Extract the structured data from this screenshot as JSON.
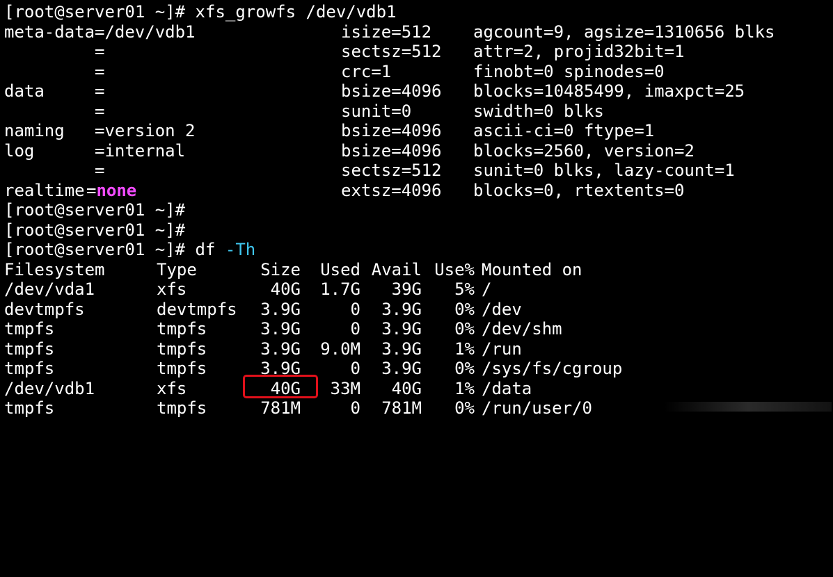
{
  "xfs_growfs": {
    "prompt": "[root@server01 ~]# ",
    "command": "xfs_growfs /dev/vdb1",
    "rows": [
      {
        "section": "meta-data",
        "field": "=/dev/vdb1",
        "param": "isize=512",
        "info": "agcount=9, agsize=1310656 blks"
      },
      {
        "section": "",
        "field": "=",
        "param": "sectsz=512",
        "info": "attr=2, projid32bit=1"
      },
      {
        "section": "",
        "field": "=",
        "param": "crc=1",
        "info": "finobt=0 spinodes=0"
      },
      {
        "section": "data",
        "field": "=",
        "param": "bsize=4096",
        "info": "blocks=10485499, imaxpct=25"
      },
      {
        "section": "",
        "field": "=",
        "param": "sunit=0",
        "info": "swidth=0 blks"
      },
      {
        "section": "naming",
        "field": "=version 2",
        "param": "bsize=4096",
        "info": "ascii-ci=0 ftype=1"
      },
      {
        "section": "log",
        "field": "=internal",
        "param": "bsize=4096",
        "info": "blocks=2560, version=2"
      },
      {
        "section": "",
        "field": "=",
        "param": "sectsz=512",
        "info": "sunit=0 blks, lazy-count=1"
      }
    ],
    "realtime": {
      "section": "realtime",
      "eq": "=",
      "value": "none",
      "param": "extsz=4096",
      "info": "blocks=0, rtextents=0"
    }
  },
  "empty_prompts": [
    "[root@server01 ~]#",
    "[root@server01 ~]#"
  ],
  "df": {
    "prompt": "[root@server01 ~]# ",
    "command": "df",
    "flag": "-Th",
    "headers": [
      "Filesystem",
      "Type",
      "Size",
      "Used",
      "Avail",
      "Use%",
      "Mounted on"
    ],
    "rows": [
      [
        "/dev/vda1",
        "xfs",
        "40G",
        "1.7G",
        "39G",
        "5%",
        "/"
      ],
      [
        "devtmpfs",
        "devtmpfs",
        "3.9G",
        "0",
        "3.9G",
        "0%",
        "/dev"
      ],
      [
        "tmpfs",
        "tmpfs",
        "3.9G",
        "0",
        "3.9G",
        "0%",
        "/dev/shm"
      ],
      [
        "tmpfs",
        "tmpfs",
        "3.9G",
        "9.0M",
        "3.9G",
        "1%",
        "/run"
      ],
      [
        "tmpfs",
        "tmpfs",
        "3.9G",
        "0",
        "3.9G",
        "0%",
        "/sys/fs/cgroup"
      ],
      [
        "/dev/vdb1",
        "xfs",
        "40G",
        "33M",
        "40G",
        "1%",
        "/data"
      ],
      [
        "tmpfs",
        "tmpfs",
        "781M",
        "0",
        "781M",
        "0%",
        "/run/user/0"
      ]
    ]
  },
  "colors": {
    "background": "#000000",
    "text": "#ffffff",
    "none_highlight": "#f14bff",
    "flag_highlight": "#3fc7f0",
    "annotation_box": "#e0101a"
  }
}
